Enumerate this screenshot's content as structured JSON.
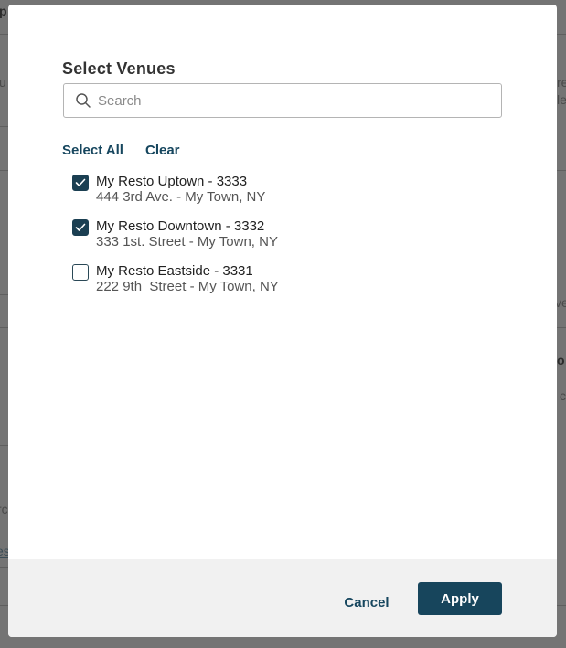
{
  "background": {
    "fragments": {
      "f1": "p",
      "f2": "u",
      "f3": "re",
      "f4": "le",
      "f5": "ve",
      "f6": "o",
      "f7": "c",
      "f8": "rc",
      "f9": "es"
    }
  },
  "modal": {
    "title": "Select Venues",
    "search": {
      "placeholder": "Search",
      "value": ""
    },
    "select_all_label": "Select All",
    "clear_label": "Clear",
    "venues": [
      {
        "name": "My Resto Uptown - 3333",
        "address": "444 3rd Ave. - My Town, NY",
        "checked": true
      },
      {
        "name": "My Resto Downtown - 3332",
        "address": "333 1st. Street - My Town, NY",
        "checked": true
      },
      {
        "name": "My Resto Eastside - 3331",
        "address": "222 9th  Street - My Town, NY",
        "checked": false
      }
    ],
    "footer": {
      "cancel_label": "Cancel",
      "apply_label": "Apply"
    }
  },
  "colors": {
    "accent": "#17455c",
    "checkbox_checked": "#1b3f52",
    "link": "#16465e",
    "overlay": "#747474"
  }
}
